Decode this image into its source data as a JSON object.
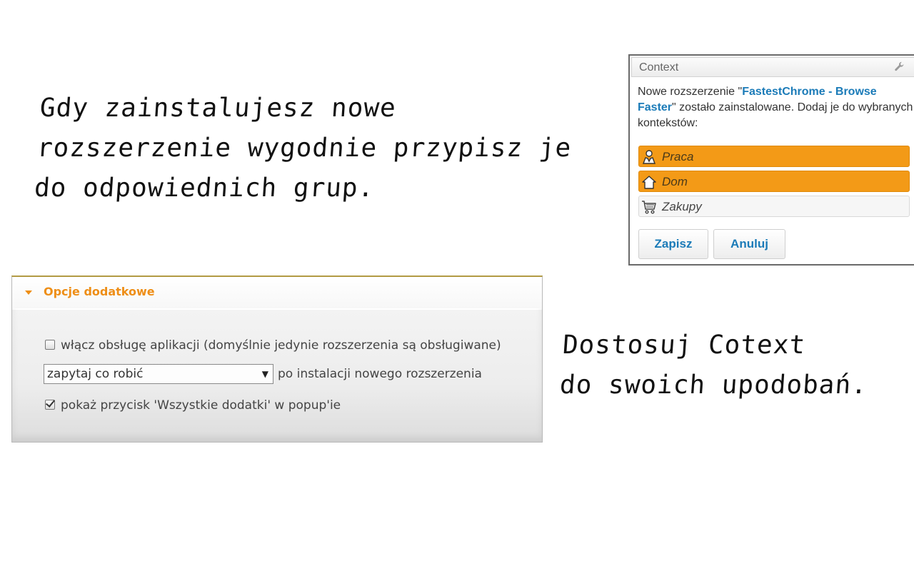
{
  "captions": {
    "top": [
      "Gdy zainstalujesz nowe",
      "rozszerzenie wygodnie przypisz je",
      "do odpowiednich grup."
    ],
    "right": [
      "Dostosuj Cotext",
      "do swoich upodobań."
    ]
  },
  "popup": {
    "title": "Context",
    "message_prefix": "Nowe rozszerzenie \"",
    "extension_name": "FastestChrome - Browse Faster",
    "message_suffix": "\" zostało zainstalowane. Dodaj je do wybranych kontekstów:",
    "contexts": [
      {
        "label": "Praca",
        "icon": "work-person-icon",
        "checked": true
      },
      {
        "label": "Dom",
        "icon": "home-icon",
        "checked": true
      },
      {
        "label": "Zakupy",
        "icon": "shopping-cart-icon",
        "checked": false
      }
    ],
    "save_label": "Zapisz",
    "cancel_label": "Anuluj"
  },
  "options": {
    "title": "Opcje dodatkowe",
    "apps_checkbox": {
      "label": "włącz obsługę aplikacji (domyślnie jedynie rozszerzenia są obsługiwane)",
      "checked": false
    },
    "install_action": {
      "selected": "zapytaj co robić",
      "suffix": "po instalacji nowego rozszerzenia"
    },
    "all_addons_checkbox": {
      "label": "pokaż przycisk 'Wszystkie dodatki' w popup'ie",
      "checked": true
    }
  },
  "colors": {
    "accent_orange": "#f39a17",
    "link_blue": "#1b7bb8"
  }
}
